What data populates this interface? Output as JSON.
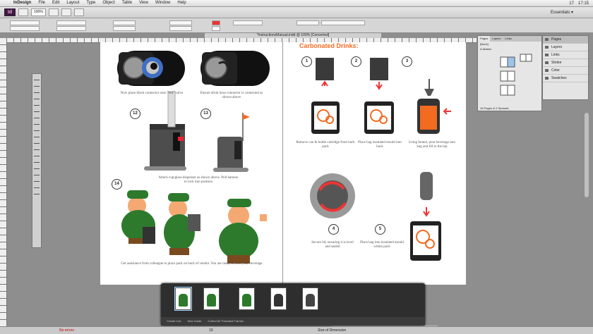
{
  "menubar": {
    "app_name": "InDesign",
    "menus": [
      "File",
      "Edit",
      "Layout",
      "Type",
      "Object",
      "Table",
      "View",
      "Window",
      "Help"
    ],
    "status": "17",
    "time": "17:15"
  },
  "appbar": {
    "logo": "Id",
    "zoom_select": "100%",
    "workspace": "Essentials ▾"
  },
  "document": {
    "tab_title": "*InstructionsManual.indd @ 100% [Converted]"
  },
  "left_page": {
    "captions": [
      "Now place black connector onto \"out\" valve",
      "Ensure drink hose connector is connected as shown above",
      "Attach cup/glass dispenser as shown above. Pull harness to lock into position",
      "Get assistance from colleague to place pack on back of vendor. You are ready to send your beverage."
    ],
    "step_numbers": [
      "12",
      "13",
      "14"
    ]
  },
  "right_page": {
    "heading": "Carbonated Drinks:",
    "captions": [
      "Remove can & bottle cartridge from back pack",
      "Place bag insulated mould into back",
      "Using funnel, pour beverage into bag and fill to the top",
      "Secure lid, ensuring it is level and sealed",
      "Place bag into insulated mould within pack"
    ],
    "step_numbers": [
      "1",
      "2",
      "3",
      "4",
      "5"
    ]
  },
  "pages_panel": {
    "tabs": [
      "Pages",
      "Layers",
      "Links"
    ],
    "rows": [
      "[None]",
      "A-Master"
    ],
    "footer": "16 Pages in 9 Spreads"
  },
  "side_panel": {
    "items": [
      "Pages",
      "Layers",
      "Links",
      "Stroke",
      "Color",
      "Swatches"
    ]
  },
  "thumb_strip": {
    "footer_items": [
      "Create Link",
      "New Guide",
      "Collect All Threaded Frames"
    ]
  },
  "statusbar": {
    "zoom": "No errors",
    "page": "19",
    "message": "Size of Dimension"
  }
}
